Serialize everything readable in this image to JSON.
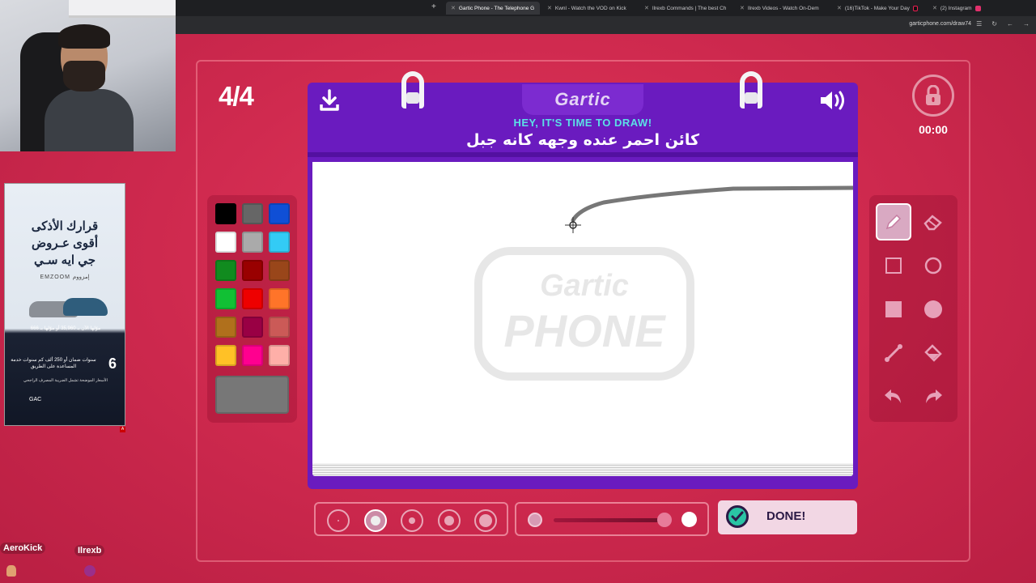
{
  "browser": {
    "tabs": [
      {
        "label": "Gartic Phone - The Telephone G",
        "active": true
      },
      {
        "label": "Kwnl - Watch the VOD on Kick",
        "active": false
      },
      {
        "label": "Ilrexb Commands | The best Ch",
        "active": false
      },
      {
        "label": "Ilrexb Videos - Watch On-Dem",
        "active": false
      },
      {
        "label": "(16)TikTok - Make Your Day",
        "active": false
      },
      {
        "label": "(2) Instagram",
        "active": false
      }
    ],
    "url": "garticphone.com/draw74"
  },
  "ad": {
    "headline_lines": [
      "قرارك الأذكى",
      "أقوى عـروض",
      "جي ايه سـي"
    ],
    "brand": "EMZOOM إمزووم",
    "price_text": "موّلها الآن بـ 35,960 أو موّلها بـ 666",
    "years": "6",
    "years_text": "سنوات ضمان أو 250 ألف كم سنوات خدمة المساعدة على الطريق",
    "bank_text": "الأسعار الموضحة تشمل الضريبة المصرف الراجحي",
    "footer_brand": "GAC"
  },
  "game": {
    "round": "4/4",
    "timer": "00:00",
    "logo": "Gartic",
    "prompt_title": "HEY, IT'S TIME TO DRAW!",
    "prompt_text": "كائن احمر عنده وجهه كانه جبل",
    "watermark_line1": "Gartic",
    "watermark_line2": "PHONE",
    "done_label": "DONE!"
  },
  "palette": [
    {
      "name": "black",
      "color": "#000000"
    },
    {
      "name": "gray",
      "color": "#666666"
    },
    {
      "name": "blue",
      "color": "#0f4fd6"
    },
    {
      "name": "white",
      "color": "#ffffff"
    },
    {
      "name": "light-gray",
      "color": "#aaaaaa"
    },
    {
      "name": "cyan",
      "color": "#33cbf5"
    },
    {
      "name": "green",
      "color": "#118b1f"
    },
    {
      "name": "dark-red",
      "color": "#990000"
    },
    {
      "name": "brown",
      "color": "#99461a"
    },
    {
      "name": "light-green",
      "color": "#11c034"
    },
    {
      "name": "red",
      "color": "#ee0000"
    },
    {
      "name": "orange",
      "color": "#ff7429"
    },
    {
      "name": "tan",
      "color": "#b0701c"
    },
    {
      "name": "maroon",
      "color": "#990044"
    },
    {
      "name": "salmon",
      "color": "#cb5a57"
    },
    {
      "name": "yellow",
      "color": "#ffc126"
    },
    {
      "name": "pink",
      "color": "#ff008f"
    },
    {
      "name": "light-pink",
      "color": "#feafa8"
    }
  ],
  "current_color": "#777777",
  "tools": [
    "pencil",
    "eraser",
    "square-outline",
    "circle-outline",
    "square-filled",
    "circle-filled",
    "line",
    "fill-bucket",
    "undo",
    "redo"
  ],
  "active_tool": "pencil",
  "stroke_sizes": 5,
  "selected_size": 2,
  "overlays": {
    "left_name": "AeroKick",
    "right_name": "Ilrexb"
  }
}
